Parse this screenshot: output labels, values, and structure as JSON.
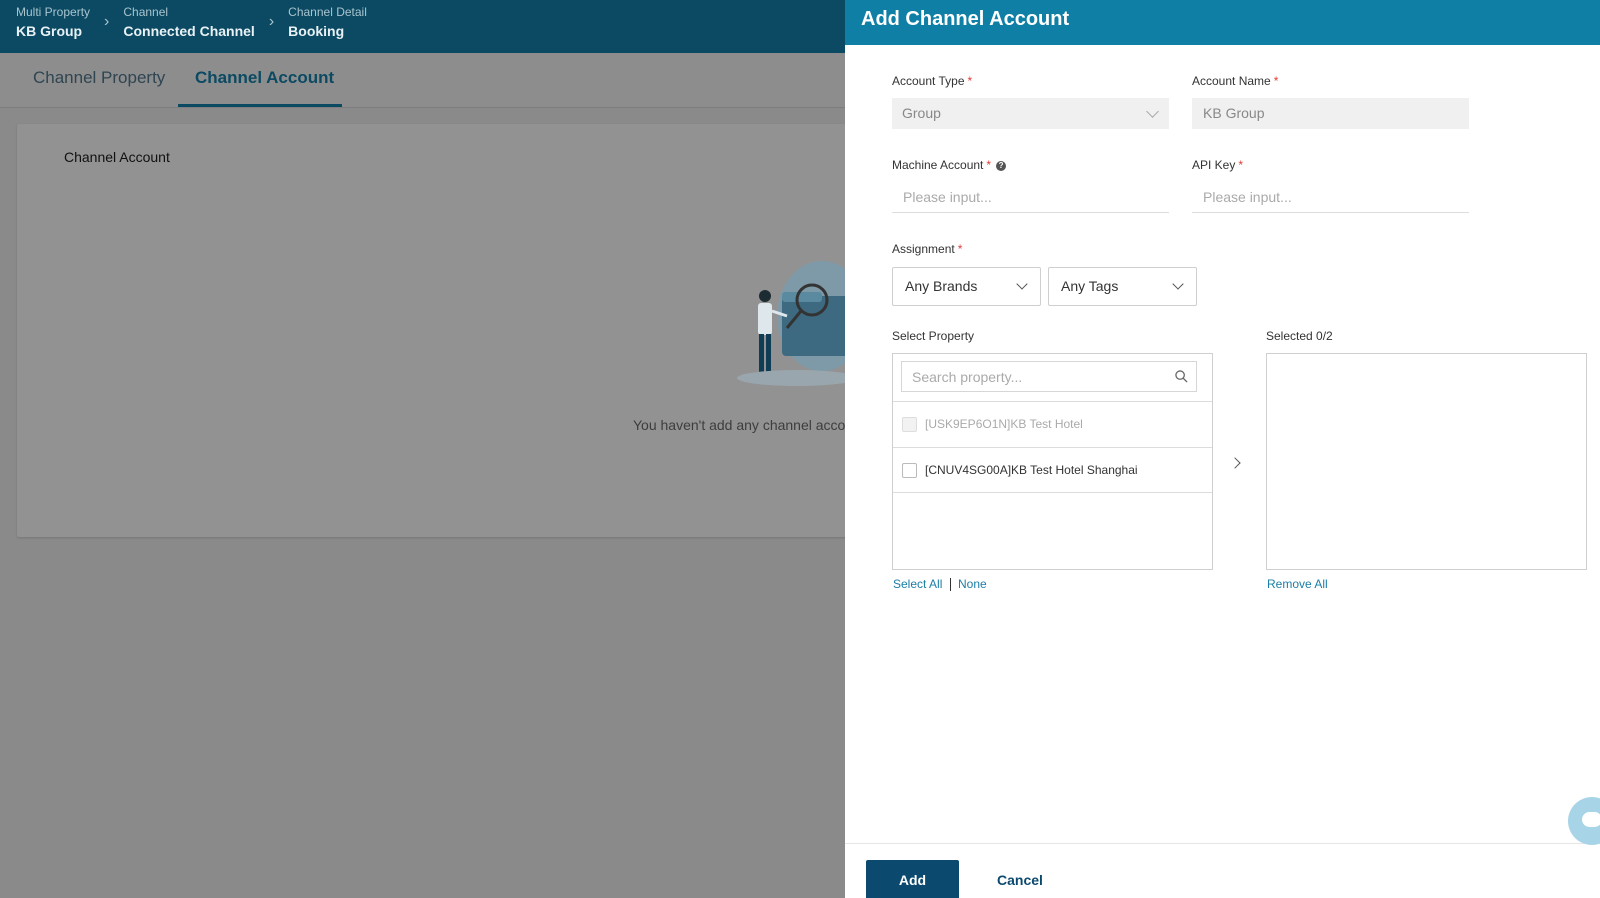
{
  "breadcrumb": [
    {
      "sub": "Multi Property",
      "main": "KB Group"
    },
    {
      "sub": "Channel",
      "main": "Connected Channel"
    },
    {
      "sub": "Channel Detail",
      "main": "Booking"
    }
  ],
  "tabs": [
    {
      "label": "Channel Property"
    },
    {
      "label": "Channel Account"
    }
  ],
  "card": {
    "title": "Channel Account",
    "empty_text": "You haven't add any channel acco"
  },
  "drawer": {
    "title": "Add Channel Account",
    "account_type": {
      "label": "Account Type",
      "value": "Group"
    },
    "account_name": {
      "label": "Account Name",
      "value": "KB Group"
    },
    "machine_account": {
      "label": "Machine Account",
      "placeholder": "Please input..."
    },
    "api_key": {
      "label": "API Key",
      "placeholder": "Please input..."
    },
    "assignment": {
      "label": "Assignment",
      "brands": "Any Brands",
      "tags": "Any Tags"
    },
    "select_property": {
      "label": "Select Property",
      "search_placeholder": "Search property...",
      "items": [
        {
          "label": "[USK9EP6O1N]KB Test Hotel",
          "disabled": true
        },
        {
          "label": "[CNUV4SG00A]KB Test Hotel Shanghai",
          "disabled": false
        }
      ],
      "select_all": "Select All",
      "none": "None"
    },
    "selected": {
      "label": "Selected 0/2",
      "remove_all": "Remove All"
    },
    "add_label": "Add",
    "cancel_label": "Cancel"
  },
  "icons": {
    "required_mark": "*",
    "help": "?"
  }
}
